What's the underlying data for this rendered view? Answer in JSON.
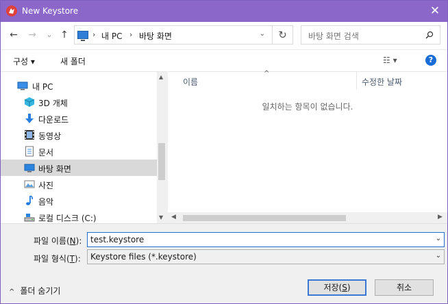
{
  "window": {
    "title": "New Keystore",
    "close_glyph": "✕",
    "app_icon": "keystore-app-icon"
  },
  "nav": {
    "back_glyph": "←",
    "forward_glyph": "→",
    "recent_glyph": "⌄",
    "up_glyph": "↑",
    "breadcrumb": [
      "내 PC",
      "바탕 화면"
    ],
    "breadcrumb_sep": "›",
    "address_dropdown_glyph": "⌄",
    "refresh_glyph": "↻",
    "search_placeholder": "바탕 화면 검색"
  },
  "toolbar": {
    "organize_label": "구성 ▾",
    "new_folder_label": "새 폴더",
    "view_glyph": "☷ ▾",
    "help_glyph": "?"
  },
  "sidebar": {
    "items": [
      {
        "label": "내 PC",
        "icon": "pc-icon",
        "selected": false
      },
      {
        "label": "3D 개체",
        "icon": "3d-objects-icon",
        "selected": false
      },
      {
        "label": "다운로드",
        "icon": "download-icon",
        "selected": false
      },
      {
        "label": "동영상",
        "icon": "video-icon",
        "selected": false
      },
      {
        "label": "문서",
        "icon": "document-icon",
        "selected": false
      },
      {
        "label": "바탕 화면",
        "icon": "desktop-icon",
        "selected": true
      },
      {
        "label": "사진",
        "icon": "pictures-icon",
        "selected": false
      },
      {
        "label": "음악",
        "icon": "music-icon",
        "selected": false
      },
      {
        "label": "로컬 디스크 (C:)",
        "icon": "drive-icon",
        "selected": false
      }
    ]
  },
  "file_list": {
    "columns": [
      "이름",
      "수정한 날짜"
    ],
    "sort_glyph": "^",
    "empty_message": "일치하는 항목이 없습니다."
  },
  "form": {
    "filename_label_pre": "파일 이름(",
    "filename_label_key": "N",
    "filename_label_post": "):",
    "filename_value": "test.keystore",
    "filetype_label_pre": "파일 형식(",
    "filetype_label_key": "T",
    "filetype_label_post": "):",
    "filetype_value": "Keystore files (*.keystore)",
    "dropdown_glyph": "⌄"
  },
  "footer": {
    "hide_folders_label": "폴더 숨기기",
    "hide_folders_glyph": "^",
    "save_pre": "저장(",
    "save_key": "S",
    "save_post": ")",
    "cancel_label": "취소"
  }
}
